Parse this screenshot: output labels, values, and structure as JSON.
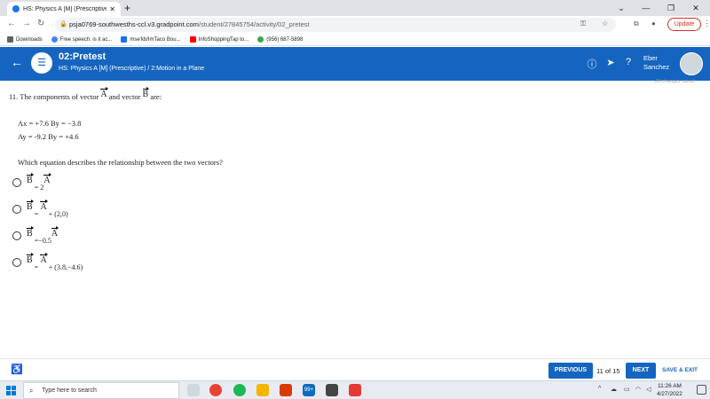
{
  "browser": {
    "tab_title": "HS: Physics A [M] (Prescriptive) - ",
    "url_host": "psja0769-southwesths-ccl.v3.gradpoint.com",
    "url_path": "/student/27845754/activity/02_pretest",
    "update_label": "Update",
    "bookmarks": [
      {
        "label": "Downloads",
        "color": "#5f6368"
      },
      {
        "label": "Free speech: is it ac...",
        "color": "#4285f4"
      },
      {
        "label": "mse'kb/ImTaco Bou...",
        "color": "#1a73e8"
      },
      {
        "label": "InfoShoppingTap to...",
        "color": "#ff0000"
      },
      {
        "label": "(956) 687-5898",
        "color": "#34a853"
      }
    ]
  },
  "header": {
    "title": "02:Pretest",
    "breadcrumb": "HS: Physics A [M] (Prescriptive) / 2:Motion in a Plane",
    "user_first": "Eber",
    "user_last": "Sanchez",
    "saved_status": "All changes saved",
    "accent": "#1565c0"
  },
  "question": {
    "number": "11.",
    "lead": "The components of vector",
    "vec_a": "A",
    "and_vector": "and vector",
    "vec_b": "B",
    "are": "are:",
    "line1": "Ax = +7.6 By = −3.8",
    "line2": "Ay = -9.2 By = +4.6",
    "prompt": "Which equation describes the relationship between the two vectors?",
    "choices": [
      {
        "lhs": "B",
        "eq": "= 2",
        "rhs": "A",
        "tail": ""
      },
      {
        "lhs": "B",
        "eq": "=",
        "rhs": "A",
        "tail": "+ (2,0)"
      },
      {
        "lhs": "B",
        "eq": "=−0.5",
        "rhs": "A",
        "tail": ""
      },
      {
        "lhs": "B",
        "eq": "=",
        "rhs": "A",
        "tail": "+ (3.8,−4.6)"
      }
    ]
  },
  "footer": {
    "previous": "PREVIOUS",
    "counter": "11 of 15",
    "next": "NEXT",
    "save_exit": "SAVE & EXIT"
  },
  "taskbar": {
    "search_placeholder": "Type here to search",
    "time": "11:26 AM",
    "date": "4/27/2022",
    "badge": "99+"
  }
}
